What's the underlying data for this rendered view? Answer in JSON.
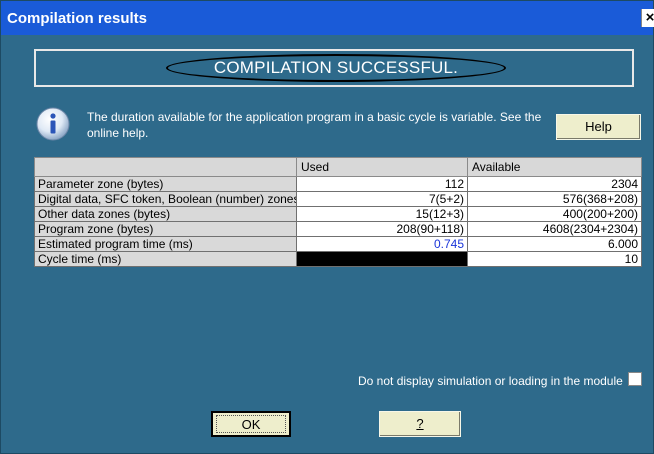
{
  "window": {
    "title": "Compilation results",
    "close_label": "×"
  },
  "banner": {
    "text": "COMPILATION SUCCESSFUL."
  },
  "info": {
    "icon": "info-icon",
    "text": "The duration available for the application program in a basic cycle is variable. See the online help."
  },
  "help_button": {
    "label": "Help"
  },
  "table": {
    "headers": {
      "used": "Used",
      "available": "Available"
    },
    "rows": [
      {
        "label": "Parameter zone (bytes)",
        "used": "112",
        "available": "2304"
      },
      {
        "label": "Digital data, SFC token, Boolean (number) zones",
        "used": "7(5+2)",
        "available": "576(368+208)"
      },
      {
        "label": "Other data zones (bytes)",
        "used": "15(12+3)",
        "available": "400(200+200)"
      },
      {
        "label": "Program zone (bytes)",
        "used": "208(90+118)",
        "available": "4608(2304+2304)"
      },
      {
        "label": "Estimated program time (ms)",
        "used": "0.745",
        "available": "6.000"
      },
      {
        "label": "Cycle time (ms)",
        "used": "",
        "available": "10"
      }
    ]
  },
  "options": {
    "no_display_label": "Do not display simulation or loading in the module",
    "no_display_checked": false
  },
  "buttons": {
    "ok_label": "OK",
    "help2_label": "?"
  },
  "colors": {
    "dialog_bg": "#2e6a8b",
    "titlebar": "#1a5bd8",
    "button_bg": "#eeeecc",
    "highlight_value": "#1a35d9"
  }
}
